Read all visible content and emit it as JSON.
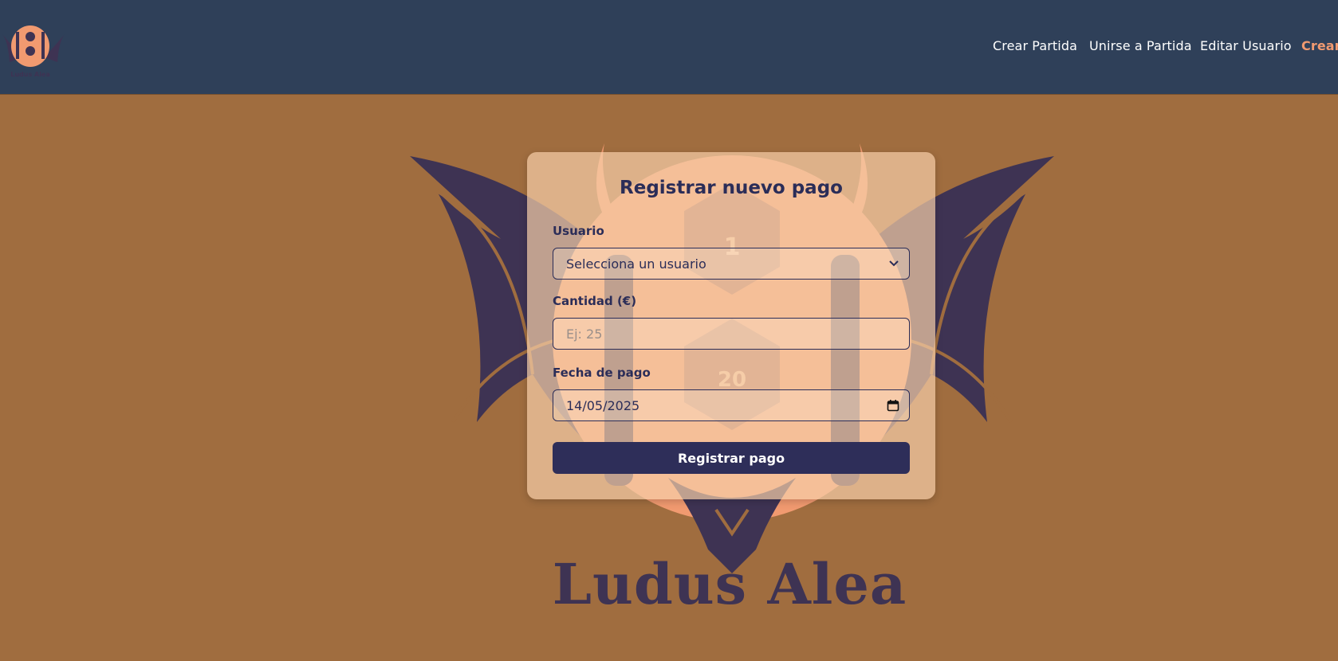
{
  "brand": {
    "name": "Ludus Alea",
    "logo_caption": "Ludus Alea"
  },
  "nav": {
    "items": [
      {
        "label": "Crear Partida"
      },
      {
        "label": "Unirse a Partida"
      },
      {
        "label": "Editar Usuario"
      },
      {
        "label": "Crear"
      }
    ]
  },
  "form": {
    "title": "Registrar nuevo pago",
    "usuario": {
      "label": "Usuario",
      "selected": "Selecciona un usuario"
    },
    "cantidad": {
      "label": "Cantidad (€)",
      "placeholder": "Ej: 25",
      "value": ""
    },
    "fecha": {
      "label": "Fecha de pago",
      "value": "14/05/2025"
    },
    "submit_label": "Registrar pago"
  },
  "emblem": {
    "die_top": "1",
    "die_bottom": "20"
  },
  "icons": {
    "dropdown": "chevron-down-icon",
    "date": "calendar-icon",
    "logo": "bat-dice-logo-icon"
  },
  "colors": {
    "header_bg": "#2f4059",
    "page_bg": "#a06d3f",
    "accent": "#f19a70",
    "primary": "#2e2e59",
    "emblem": "#3e3353"
  }
}
